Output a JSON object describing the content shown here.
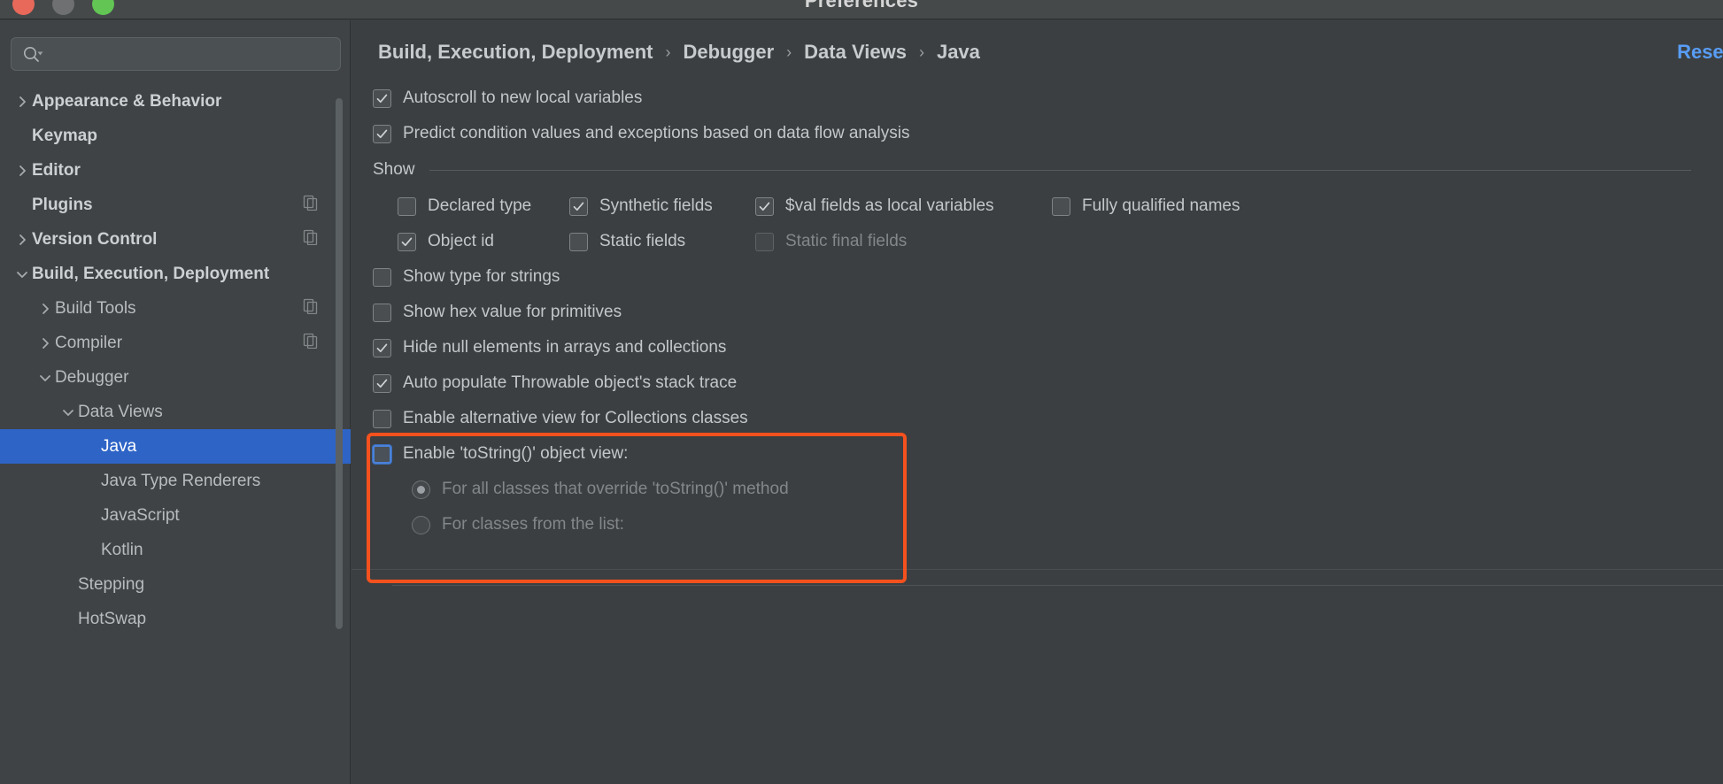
{
  "window": {
    "title": "Preferences",
    "traffic_lights": [
      "close",
      "minimize",
      "maximize"
    ]
  },
  "colors": {
    "accent_selection": "#2e64c6",
    "link": "#589df6",
    "annotation": "#f4511e",
    "background": "#3c3f41",
    "sidebar_background": "#3f4345"
  },
  "search": {
    "placeholder": "",
    "value": "",
    "icon": "search-icon"
  },
  "sidebar": {
    "items": [
      {
        "label": "Appearance & Behavior",
        "indent": 0,
        "chevron": "right",
        "bold": true,
        "selected": false,
        "copy_icon": false
      },
      {
        "label": "Keymap",
        "indent": 0,
        "chevron": "none",
        "bold": true,
        "selected": false,
        "copy_icon": false
      },
      {
        "label": "Editor",
        "indent": 0,
        "chevron": "right",
        "bold": true,
        "selected": false,
        "copy_icon": false
      },
      {
        "label": "Plugins",
        "indent": 0,
        "chevron": "none",
        "bold": true,
        "selected": false,
        "copy_icon": true
      },
      {
        "label": "Version Control",
        "indent": 0,
        "chevron": "right",
        "bold": true,
        "selected": false,
        "copy_icon": true
      },
      {
        "label": "Build, Execution, Deployment",
        "indent": 0,
        "chevron": "down",
        "bold": true,
        "selected": false,
        "copy_icon": false
      },
      {
        "label": "Build Tools",
        "indent": 1,
        "chevron": "right",
        "bold": false,
        "selected": false,
        "copy_icon": true
      },
      {
        "label": "Compiler",
        "indent": 1,
        "chevron": "right",
        "bold": false,
        "selected": false,
        "copy_icon": true
      },
      {
        "label": "Debugger",
        "indent": 1,
        "chevron": "down",
        "bold": false,
        "selected": false,
        "copy_icon": false
      },
      {
        "label": "Data Views",
        "indent": 2,
        "chevron": "down",
        "bold": false,
        "selected": false,
        "copy_icon": false
      },
      {
        "label": "Java",
        "indent": 3,
        "chevron": "none",
        "bold": false,
        "selected": true,
        "copy_icon": false
      },
      {
        "label": "Java Type Renderers",
        "indent": 3,
        "chevron": "none",
        "bold": false,
        "selected": false,
        "copy_icon": false
      },
      {
        "label": "JavaScript",
        "indent": 3,
        "chevron": "none",
        "bold": false,
        "selected": false,
        "copy_icon": false
      },
      {
        "label": "Kotlin",
        "indent": 3,
        "chevron": "none",
        "bold": false,
        "selected": false,
        "copy_icon": false
      },
      {
        "label": "Stepping",
        "indent": 2,
        "chevron": "none",
        "bold": false,
        "selected": false,
        "copy_icon": false
      },
      {
        "label": "HotSwap",
        "indent": 2,
        "chevron": "none",
        "bold": false,
        "selected": false,
        "copy_icon": false
      }
    ]
  },
  "header": {
    "breadcrumb": [
      "Build, Execution, Deployment",
      "Debugger",
      "Data Views",
      "Java"
    ],
    "separator": "›",
    "reset_label": "Reset"
  },
  "settings": {
    "top_options": [
      {
        "label": "Autoscroll to new local variables",
        "checked": true,
        "enabled": true
      },
      {
        "label": "Predict condition values and exceptions based on data flow analysis",
        "checked": true,
        "enabled": true
      }
    ],
    "show_group": {
      "title": "Show",
      "rows": [
        [
          {
            "label": "Declared type",
            "checked": false,
            "enabled": true
          },
          {
            "label": "Synthetic fields",
            "checked": true,
            "enabled": true
          },
          {
            "label": "$val fields as local variables",
            "checked": true,
            "enabled": true
          },
          {
            "label": "Fully qualified names",
            "checked": false,
            "enabled": true
          }
        ],
        [
          {
            "label": "Object id",
            "checked": true,
            "enabled": true
          },
          {
            "label": "Static fields",
            "checked": false,
            "enabled": true
          },
          {
            "label": "Static final fields",
            "checked": false,
            "enabled": false
          }
        ]
      ]
    },
    "mid_options": [
      {
        "label": "Show type for strings",
        "checked": false,
        "enabled": true
      },
      {
        "label": "Show hex value for primitives",
        "checked": false,
        "enabled": true
      },
      {
        "label": "Hide null elements in arrays and collections",
        "checked": true,
        "enabled": true
      },
      {
        "label": "Auto populate Throwable object's stack trace",
        "checked": true,
        "enabled": true
      }
    ],
    "highlighted": {
      "alternative_view": {
        "label": "Enable alternative view for Collections classes",
        "checked": false,
        "enabled": true
      },
      "tostring_view": {
        "label": "Enable 'toString()' object view:",
        "checked": false,
        "enabled": true,
        "focused": true
      },
      "radios": [
        {
          "label": "For all classes that override 'toString()' method",
          "selected": true,
          "enabled": false
        },
        {
          "label": "For classes from the list:",
          "selected": false,
          "enabled": false
        }
      ]
    }
  }
}
